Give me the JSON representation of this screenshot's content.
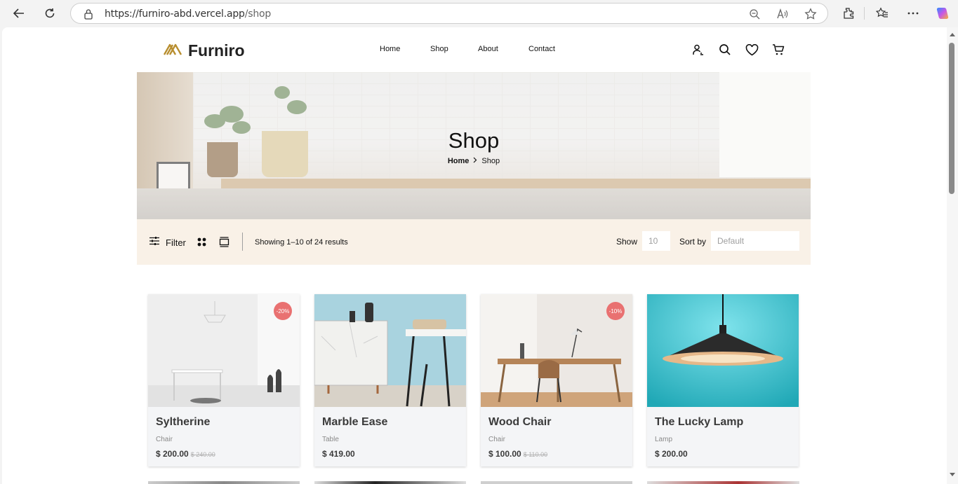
{
  "browser": {
    "url_host": "https://furniro-abd.vercel.app",
    "url_path": "/shop"
  },
  "header": {
    "brand": "Furniro",
    "nav": [
      "Home",
      "Shop",
      "About",
      "Contact"
    ]
  },
  "banner": {
    "title": "Shop",
    "breadcrumb_home": "Home",
    "breadcrumb_current": "Shop"
  },
  "filterbar": {
    "filter_label": "Filter",
    "results_text": "Showing 1–10 of 24 results",
    "show_label": "Show",
    "show_value": "10",
    "sort_label": "Sort by",
    "sort_value": "Default"
  },
  "products": [
    {
      "name": "Syltherine",
      "category": "Chair",
      "price": "$ 200.00",
      "old_price": "$ 240.00",
      "badge": "-20%"
    },
    {
      "name": "Marble Ease",
      "category": "Table",
      "price": "$ 419.00",
      "old_price": "",
      "badge": ""
    },
    {
      "name": "Wood Chair",
      "category": "Chair",
      "price": "$ 100.00",
      "old_price": "$ 110.00",
      "badge": "-10%"
    },
    {
      "name": "The Lucky Lamp",
      "category": "Lamp",
      "price": "$ 200.00",
      "old_price": "",
      "badge": ""
    }
  ],
  "colors": {
    "accent": "#b88e2f",
    "badge": "#e97171",
    "filterbar_bg": "#f9f1e7"
  }
}
